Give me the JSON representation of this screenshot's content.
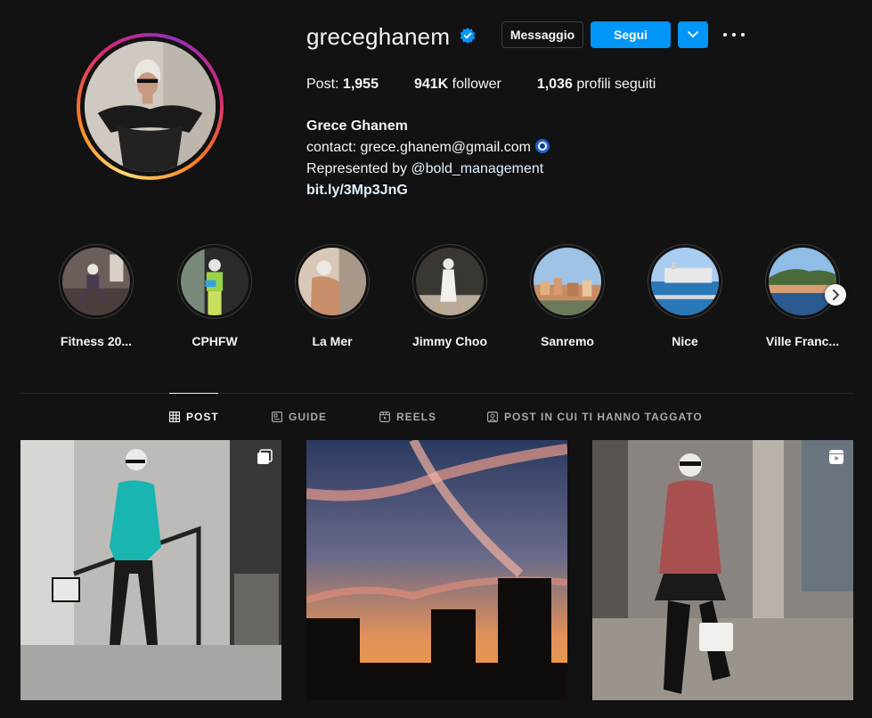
{
  "profile": {
    "username": "greceghanem",
    "message_label": "Messaggio",
    "follow_label": "Segui",
    "stats": [
      {
        "label": "Post:",
        "value": "1,955",
        "order": "label-first"
      },
      {
        "label": "follower",
        "value": "941K",
        "order": "value-first"
      },
      {
        "label": "profili seguiti",
        "value": "1,036",
        "order": "value-first"
      }
    ],
    "bio": {
      "name": "Grece Ghanem",
      "contact": "contact: grece.ghanem@gmail.com",
      "represented_prefix": "Represented by ",
      "represented_mention": "@bold_management",
      "link": "bit.ly/3Mp3JnG"
    }
  },
  "highlights": [
    {
      "label": "Fitness 20..."
    },
    {
      "label": "CPHFW"
    },
    {
      "label": "La Mer"
    },
    {
      "label": "Jimmy Choo"
    },
    {
      "label": "Sanremo"
    },
    {
      "label": "Nice"
    },
    {
      "label": "Ville Franc..."
    }
  ],
  "tabs": [
    {
      "label": "POST",
      "icon": "grid-icon",
      "active": true
    },
    {
      "label": "GUIDE",
      "icon": "guide-icon",
      "active": false
    },
    {
      "label": "REELS",
      "icon": "reels-icon",
      "active": false
    },
    {
      "label": "POST IN CUI TI HANNO TAGGATO",
      "icon": "tagged-icon",
      "active": false
    }
  ],
  "posts": [
    {
      "type": "carousel",
      "icon": "carousel-icon"
    },
    {
      "type": "photo"
    },
    {
      "type": "reel",
      "icon": "reel-icon"
    }
  ],
  "colors": {
    "background": "#121212",
    "accent": "#0095f6",
    "link": "#e0f1ff",
    "text_secondary": "#a8a8a8"
  }
}
